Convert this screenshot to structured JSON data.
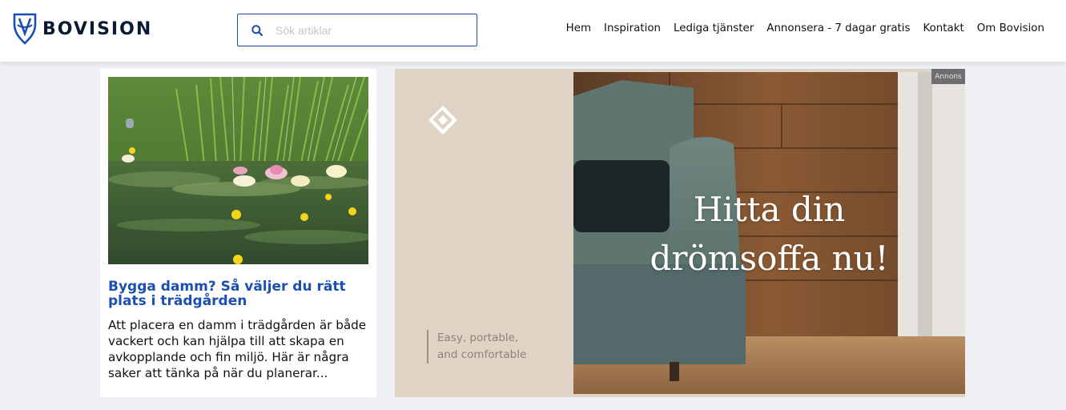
{
  "header": {
    "brand_name": "BOVISION",
    "logo_icon": "bovision-shield-icon",
    "search": {
      "placeholder": "Sök artiklar",
      "value": "",
      "icon": "search-icon"
    },
    "nav": [
      {
        "label": "Hem"
      },
      {
        "label": "Inspiration"
      },
      {
        "label": "Lediga tjänster"
      },
      {
        "label": "Annonsera - 7 dagar gratis"
      },
      {
        "label": "Kontakt"
      },
      {
        "label": "Om Bovision"
      }
    ]
  },
  "article": {
    "image": "pond-water-lilies-image",
    "title": "Bygga damm? Så väljer du rätt plats i trädgården",
    "excerpt": "Att placera en damm i trädgården är både vackert och kan hjälpa till att skapa en avkopplande och fin miljö. Här är några saker att tänka på när du planerar..."
  },
  "ad": {
    "badge": "Annons",
    "headline_line1": "Hitta din",
    "headline_line2": "drömsoffa nu!",
    "tagline_line1": "Easy, portable,",
    "tagline_line2": "and comfortable",
    "image": "green-sofa-image"
  },
  "colors": {
    "brand_blue": "#1b4fb0",
    "page_background": "#eef0f3",
    "ad_background": "#dfd3c6"
  }
}
